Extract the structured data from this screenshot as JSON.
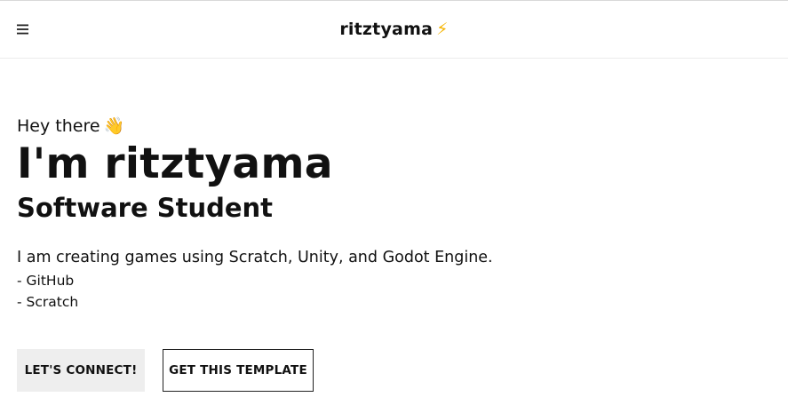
{
  "header": {
    "menu_icon": "hamburger-menu-icon",
    "brand_name": "ritztyama",
    "brand_emoji": "⚡"
  },
  "hero": {
    "greeting": "Hey there",
    "greeting_emoji": "👋",
    "name": "I'm ritztyama",
    "role": "Software Student",
    "description": "I am creating games using Scratch, Unity, and Godot Engine.",
    "links": [
      "- GitHub",
      "- Scratch"
    ]
  },
  "actions": {
    "connect_label": "LET'S CONNECT!",
    "template_label": "GET THIS TEMPLATE"
  }
}
